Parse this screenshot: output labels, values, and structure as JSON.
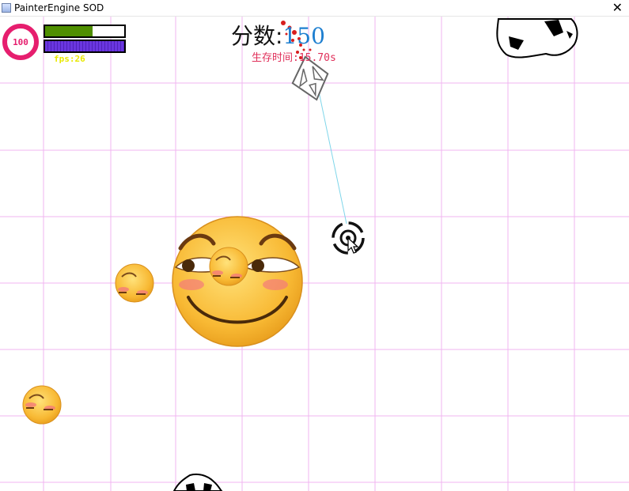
{
  "window": {
    "title": "PainterEngine SOD",
    "close_label": "✕"
  },
  "hud": {
    "health_value": "100",
    "health_bar_fraction": 0.6,
    "energy_bar_fraction": 1.0,
    "fps_text": "fps:26",
    "score_label": "分数:",
    "score_value": "150",
    "survival_text": "生存时间:15.70s"
  },
  "colors": {
    "grid": "#f0b6f0",
    "health_ring": "#e61e6e",
    "health_bar": "#4f8f00",
    "energy_bar": "#6a36e0",
    "score_value": "#1e7fd0",
    "survival_text": "#e0305a",
    "aim_line": "#7fd6ea"
  },
  "icons": {
    "player": "player-ship-icon",
    "crosshair": "crosshair-icon",
    "cursor": "mouse-cursor-icon",
    "boss": "smirk-emoji-boss",
    "minion": "blushing-emoji-minion"
  }
}
